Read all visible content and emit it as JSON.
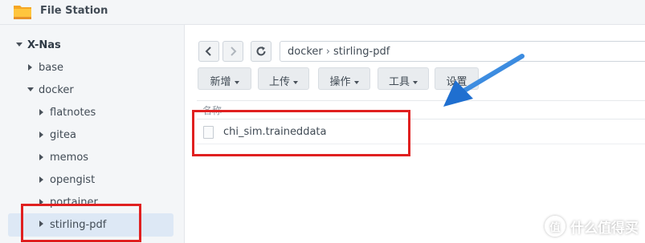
{
  "app": {
    "title": "File Station",
    "icon": "folder-icon"
  },
  "sidebar": {
    "root": {
      "label": "X-Nas",
      "expanded": true
    },
    "items": [
      {
        "label": "base",
        "expanded": false
      },
      {
        "label": "docker",
        "expanded": true
      },
      {
        "label": "flatnotes",
        "expanded": false
      },
      {
        "label": "gitea",
        "expanded": false
      },
      {
        "label": "memos",
        "expanded": false
      },
      {
        "label": "opengist",
        "expanded": false
      },
      {
        "label": "portainer",
        "expanded": false
      },
      {
        "label": "stirling-pdf",
        "expanded": false,
        "selected": true
      }
    ]
  },
  "nav": {
    "back_icon": "chevron-left-icon",
    "forward_icon": "chevron-right-icon",
    "refresh_icon": "refresh-icon",
    "path": [
      "docker",
      "stirling-pdf"
    ]
  },
  "toolbar": {
    "create": "新增",
    "upload": "上传",
    "action": "操作",
    "tools": "工具",
    "settings": "设置"
  },
  "file_list": {
    "column_name": "名称",
    "files": [
      {
        "name": "chi_sim.traineddata",
        "icon": "file-icon"
      }
    ]
  },
  "annotations": {
    "highlight_color": "#e02020",
    "arrow_color": "#2a7fe0"
  },
  "watermark": {
    "icon_text": "值",
    "text": "什么值得买"
  }
}
